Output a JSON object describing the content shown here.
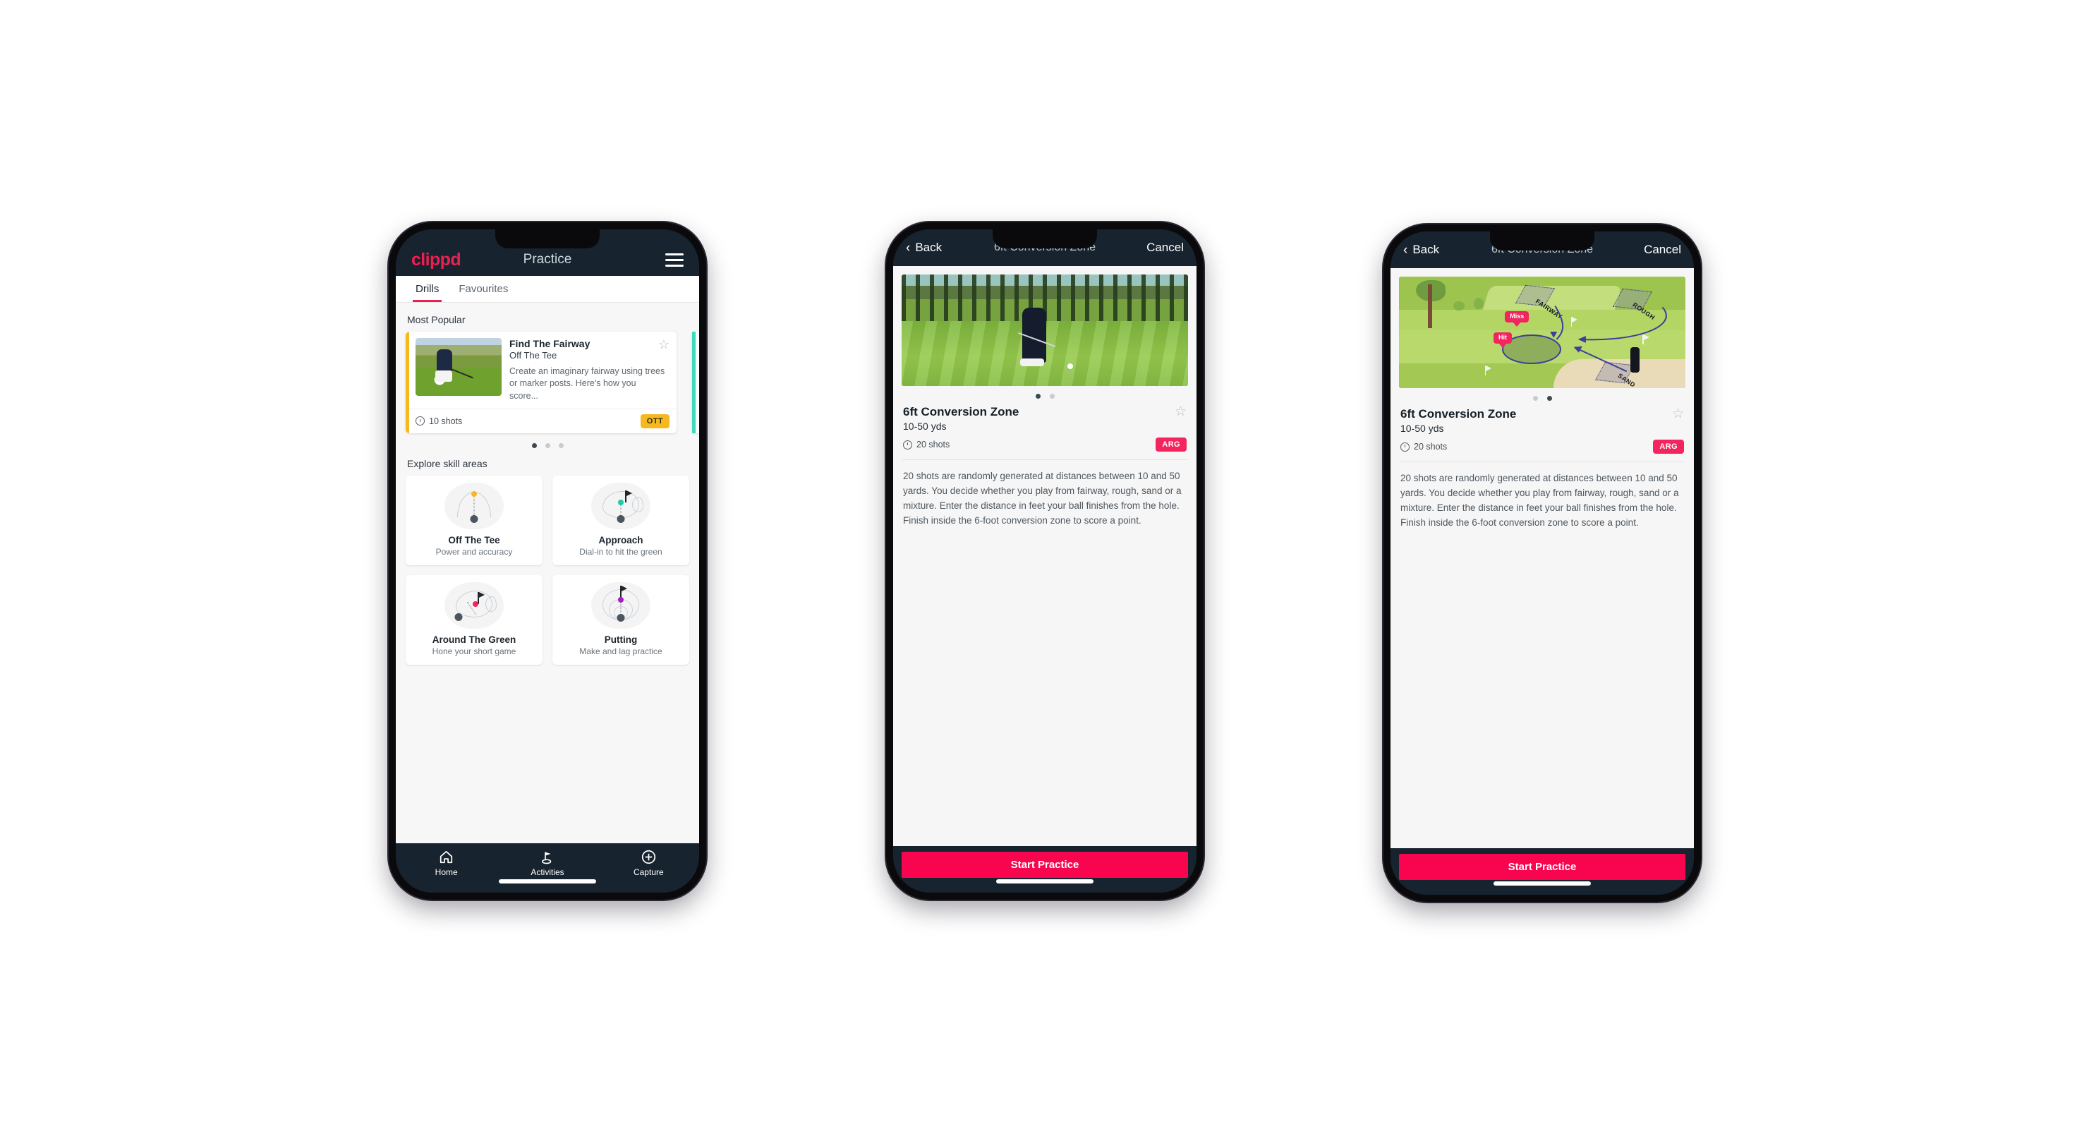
{
  "app": {
    "brand": "clippd",
    "header_title": "Practice",
    "menu_icon": "hamburger-icon"
  },
  "tabs": [
    {
      "label": "Drills",
      "active": true
    },
    {
      "label": "Favourites",
      "active": false
    }
  ],
  "sections": {
    "most_popular_label": "Most Popular",
    "explore_label": "Explore skill areas"
  },
  "featured_drill": {
    "title": "Find The Fairway",
    "subtitle": "Off The Tee",
    "description": "Create an imaginary fairway using trees or marker posts. Here's how you score...",
    "shots": "10 shots",
    "badge": "OTT",
    "badge_color": "#f6b81f",
    "accent_color": "#f6b81f",
    "next_accent_color": "#3fd9c0",
    "favourite_icon": "star-outline-icon",
    "clock_icon": "clock-icon"
  },
  "carousel": {
    "count": 3,
    "active_index": 0
  },
  "skill_areas": [
    {
      "name": "Off The Tee",
      "desc": "Power and accuracy",
      "icon": "tee-fan-icon",
      "dot_color": "#f6b81f"
    },
    {
      "name": "Approach",
      "desc": "Dial-in to hit the green",
      "icon": "green-approach-icon",
      "dot_color": "#22c9a6"
    },
    {
      "name": "Around The Green",
      "desc": "Hone your short game",
      "icon": "chip-around-green-icon",
      "dot_color": "#f4245e"
    },
    {
      "name": "Putting",
      "desc": "Make and lag practice",
      "icon": "putting-rings-icon",
      "dot_color": "#a21ec9"
    }
  ],
  "bottom_nav": [
    {
      "label": "Home",
      "icon": "home-icon",
      "active": false
    },
    {
      "label": "Activities",
      "icon": "golf-flag-icon",
      "active": true
    },
    {
      "label": "Capture",
      "icon": "plus-circle-icon",
      "active": false
    }
  ],
  "detail": {
    "back_label": "Back",
    "back_icon": "chevron-left-icon",
    "nav_title": "6ft Conversion Zone",
    "cancel_label": "Cancel",
    "title": "6ft Conversion Zone",
    "subtitle": "10-50 yds",
    "shots": "20 shots",
    "badge": "ARG",
    "badge_color": "#f4245e",
    "favourite_icon": "star-outline-icon",
    "clock_icon": "clock-icon",
    "description": "20 shots are randomly generated at distances between 10 and 50 yards. You decide whether you play from fairway, rough, sand or a mixture. Enter the distance in feet your ball finishes from the hole. Finish inside the 6-foot conversion zone to score a point.",
    "cta_label": "Start Practice",
    "cta_color": "#f9054f",
    "media_dots": {
      "count": 2,
      "active_index_phone2": 0,
      "active_index_phone3": 1
    }
  },
  "illustration": {
    "labels": [
      "FAIRWAY",
      "ROUGH",
      "SAND"
    ],
    "tags": [
      "Miss",
      "Hit"
    ]
  },
  "theme": {
    "header_bg": "#17232e",
    "brand_pink": "#ec1f52",
    "page_bg": "#f7f7f8",
    "canvas_bg": "#ffffff"
  }
}
